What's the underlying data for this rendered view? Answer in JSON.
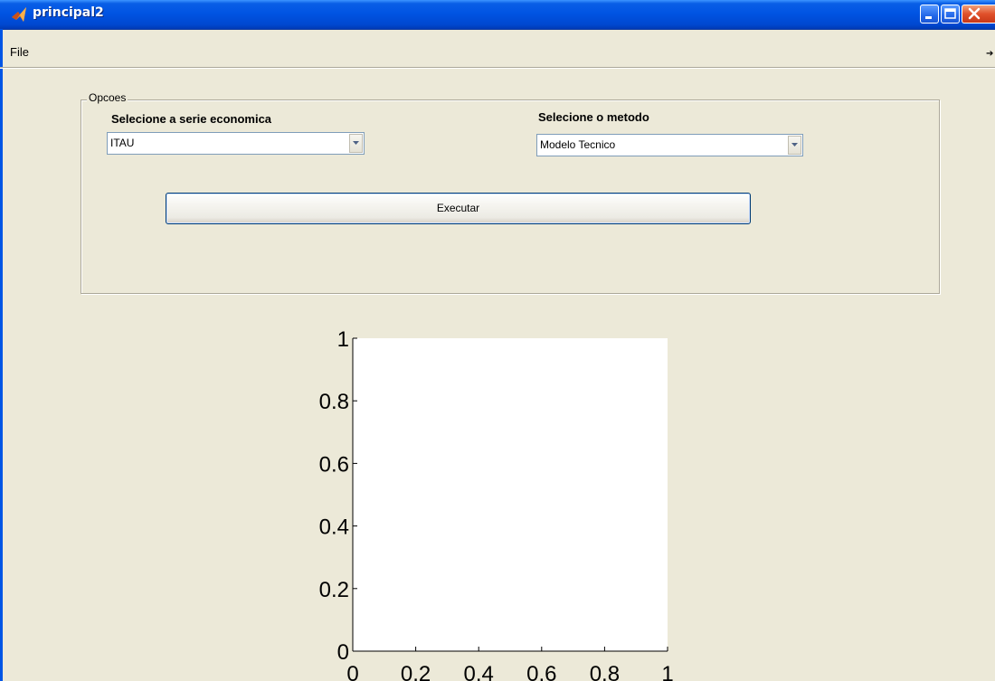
{
  "window": {
    "title": "principal2",
    "icon": "matlab-icon",
    "controls": [
      "minimize-icon",
      "maximize-icon",
      "close-icon"
    ]
  },
  "menu": {
    "file_label": "File",
    "toolbar_toggle_glyph": "➔"
  },
  "panel": {
    "title": "Opcoes",
    "serie_label": "Selecione a serie economica",
    "serie_value": "ITAU",
    "metodo_label": "Selecione o metodo",
    "metodo_value": "Modelo Tecnico",
    "execute_label": "Executar"
  },
  "chart_data": {
    "type": "line",
    "series": [],
    "xlim": [
      0,
      1
    ],
    "ylim": [
      0,
      1
    ],
    "xticks": [
      "0",
      "0.2",
      "0.4",
      "0.6",
      "0.8",
      "1"
    ],
    "yticks": [
      "0",
      "0.2",
      "0.4",
      "0.6",
      "0.8",
      "1"
    ],
    "grid": false
  }
}
